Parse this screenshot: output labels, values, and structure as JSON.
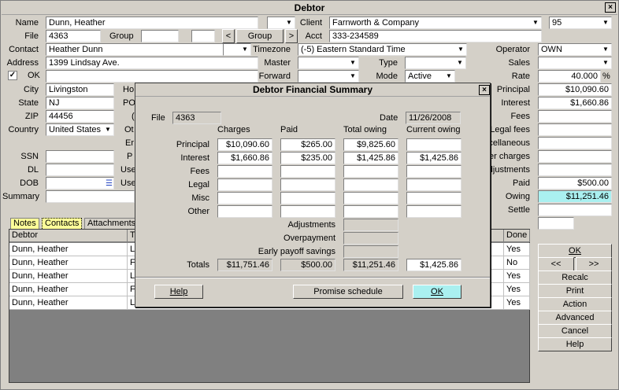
{
  "window": {
    "title": "Debtor",
    "close_glyph": "×"
  },
  "labels": {
    "name": "Name",
    "file": "File",
    "group": "Group",
    "contact": "Contact",
    "address": "Address",
    "ok_check": "OK",
    "city": "City",
    "state": "State",
    "zip": "ZIP",
    "country": "Country",
    "ssn": "SSN",
    "dl": "DL",
    "dob": "DOB",
    "summary": "Summary",
    "client": "Client",
    "acct": "Acct",
    "timezone": "Timezone",
    "master": "Master",
    "type": "Type",
    "forward": "Forward",
    "mode": "Mode",
    "operator": "Operator",
    "sales": "Sales",
    "rate": "Rate",
    "principal": "Principal",
    "interest": "Interest",
    "fees": "Fees",
    "legal_fees": "Legal fees",
    "miscellaneous": "cellaneous",
    "other_charges": "er charges",
    "adjustments": "djustments",
    "paid": "Paid",
    "owing": "Owing",
    "settle": "Settle",
    "hidden_ho": "Ho",
    "hidden_po": "PO",
    "hidden_o1": "(",
    "hidden_ot": "Ot",
    "hidden_em": "Er",
    "hidden_p": "P",
    "hidden_use1": "Use",
    "hidden_use2": "Use",
    "rate_unit": "%"
  },
  "fields": {
    "name": "Dunn, Heather",
    "file": "4363",
    "group_btn": "Group",
    "contact": "Heather Dunn",
    "address": "1399 Lindsay Ave.",
    "city": "Livingston",
    "state": "NJ",
    "zip": "44456",
    "country": "United States",
    "client": "Farnworth & Company",
    "client_code": "95",
    "acct": "333-234589",
    "timezone": "(-5) Eastern Standard Time",
    "mode": "Active",
    "operator": "OWN",
    "rate": "40.000",
    "principal": "$10,090.60",
    "interest": "$1,660.86",
    "paid": "$500.00",
    "owing": "$11,251.46",
    "ok_checked": "✓"
  },
  "nav": {
    "prev": "<",
    "next": ">",
    "first": "<<",
    "last": ">>"
  },
  "tabs": [
    "Notes",
    "Contacts",
    "Attachments"
  ],
  "grid": {
    "headers": {
      "debtor": "Debtor",
      "t": "T",
      "done": "Done"
    },
    "rows": [
      {
        "debtor": "Dunn, Heather",
        "t": "L",
        "done": "Yes"
      },
      {
        "debtor": "Dunn, Heather",
        "t": "F",
        "done": "No"
      },
      {
        "debtor": "Dunn, Heather",
        "t": "L",
        "done": "Yes"
      },
      {
        "debtor": "Dunn, Heather",
        "t": "F",
        "done": "Yes"
      },
      {
        "debtor": "Dunn, Heather",
        "t": "L",
        "done": "Yes"
      }
    ]
  },
  "side_buttons": [
    "OK",
    "Recalc",
    "Print",
    "Action",
    "Advanced",
    "Cancel",
    "Help"
  ],
  "modal": {
    "title": "Debtor Financial Summary",
    "close_glyph": "×",
    "file_label": "File",
    "file_value": "4363",
    "date_label": "Date",
    "date_value": "11/26/2008",
    "col_headers": {
      "charges": "Charges",
      "paid": "Paid",
      "total": "Total owing",
      "current": "Current owing"
    },
    "rows": [
      {
        "label": "Principal",
        "charges": "$10,090.60",
        "paid": "$265.00",
        "total": "$9,825.60",
        "current": ""
      },
      {
        "label": "Interest",
        "charges": "$1,660.86",
        "paid": "$235.00",
        "total": "$1,425.86",
        "current": "$1,425.86"
      },
      {
        "label": "Fees",
        "charges": "",
        "paid": "",
        "total": "",
        "current": ""
      },
      {
        "label": "Legal",
        "charges": "",
        "paid": "",
        "total": "",
        "current": ""
      },
      {
        "label": "Misc",
        "charges": "",
        "paid": "",
        "total": "",
        "current": ""
      },
      {
        "label": "Other",
        "charges": "",
        "paid": "",
        "total": "",
        "current": ""
      }
    ],
    "adjustments_label": "Adjustments",
    "overpayment_label": "Overpayment",
    "early_payoff_label": "Early payoff savings",
    "totals": {
      "label": "Totals",
      "charges": "$11,751.46",
      "paid": "$500.00",
      "total": "$11,251.46",
      "current": "$1,425.86"
    },
    "buttons": {
      "help": "Help",
      "promise": "Promise schedule",
      "ok": "OK"
    }
  }
}
